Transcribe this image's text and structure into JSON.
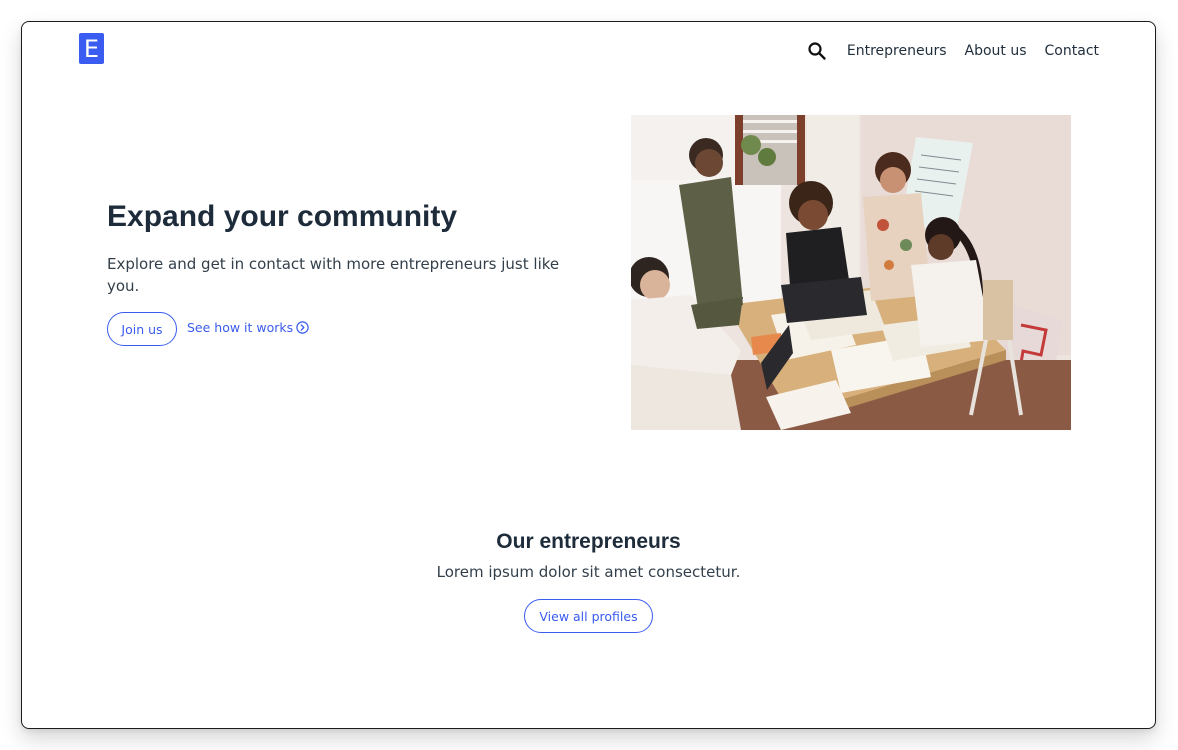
{
  "brand": {
    "logo_letter": "E",
    "logo_color": "#3a5cf0"
  },
  "nav": {
    "search_icon": "search-icon",
    "links": [
      "Entrepreneurs",
      "About us",
      "Contact"
    ]
  },
  "hero": {
    "title": "Expand your community",
    "text": "Explore and get in contact with more entrepreneurs just like you.",
    "join_label": "Join us",
    "see_label": "See how it works",
    "see_icon": "chevron-circle-right-icon"
  },
  "section": {
    "title": "Our entrepreneurs",
    "text": "Lorem ipsum dolor sit amet consectetur.",
    "button_label": "View all profiles"
  },
  "colors": {
    "accent": "#3a5cf0",
    "heading": "#1d2b3a",
    "body_text": "#33404c"
  }
}
